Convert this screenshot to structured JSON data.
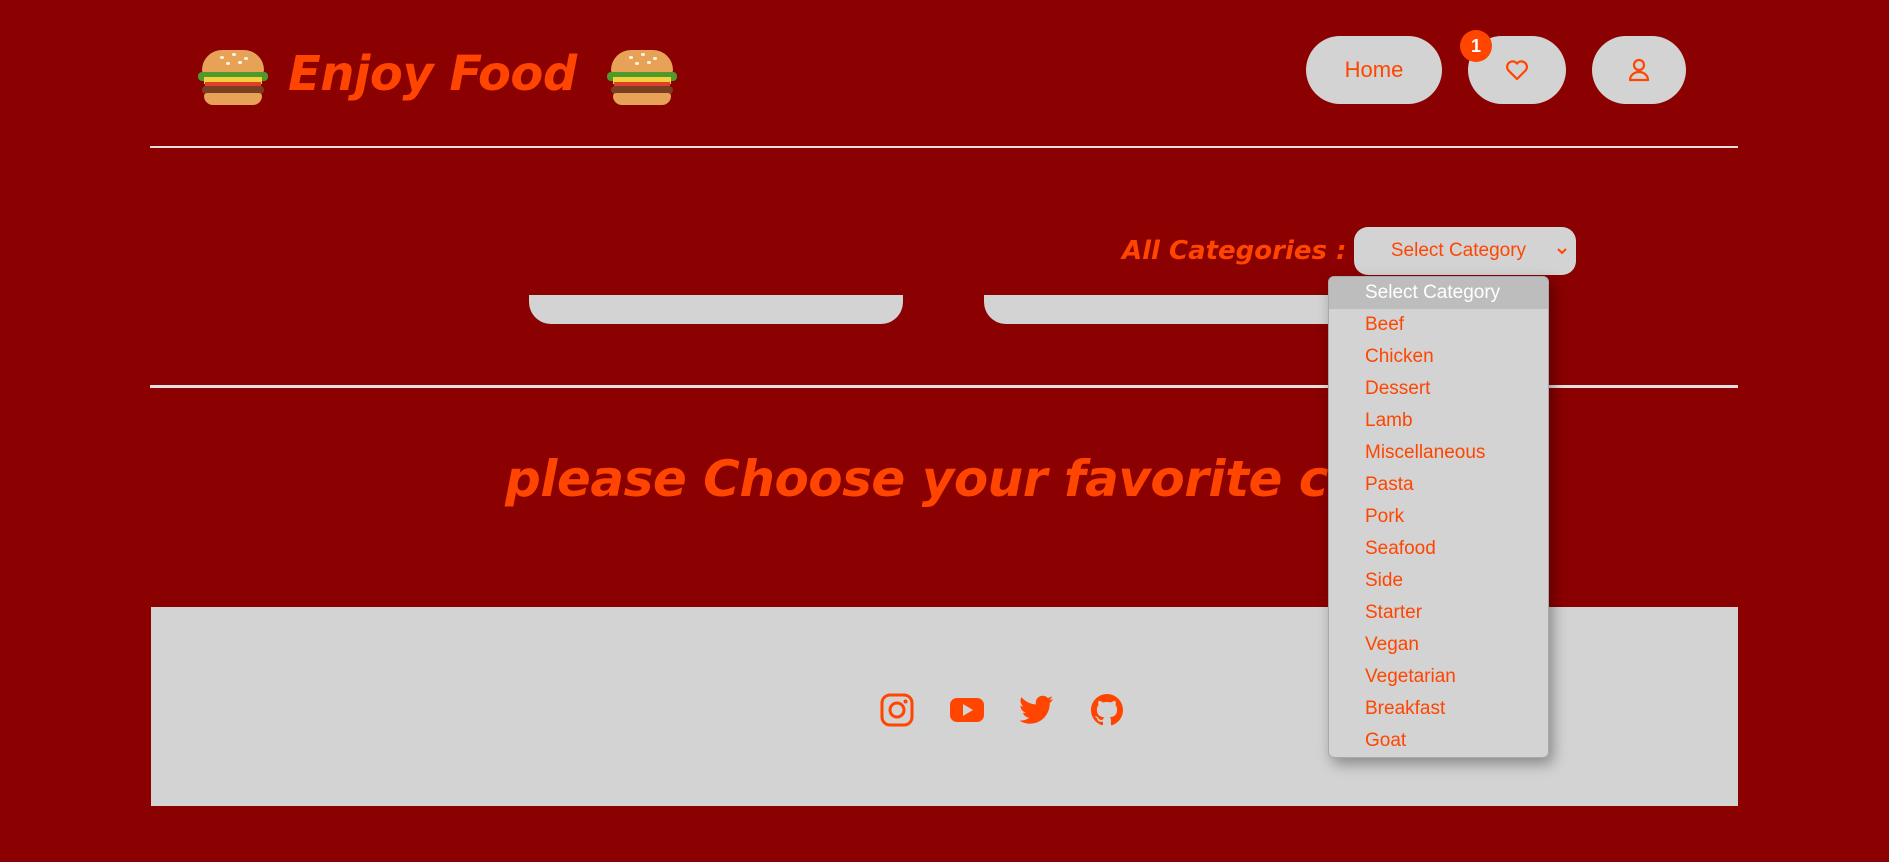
{
  "header": {
    "brand_title": "Enjoy Food",
    "nav": {
      "home_label": "Home",
      "favorites_count": "1",
      "favorites_icon": "heart-icon",
      "user_icon": "user-icon"
    }
  },
  "filter": {
    "label": "All Categories :",
    "selected": "Select Category",
    "options": [
      "Select Category",
      "Beef",
      "Chicken",
      "Dessert",
      "Lamb",
      "Miscellaneous",
      "Pasta",
      "Pork",
      "Seafood",
      "Side",
      "Starter",
      "Vegan",
      "Vegetarian",
      "Breakfast",
      "Goat"
    ]
  },
  "main": {
    "prompt": "please Choose your favorite category"
  },
  "footer": {
    "social": [
      "instagram-icon",
      "youtube-icon",
      "twitter-icon",
      "github-icon"
    ]
  },
  "colors": {
    "background": "#8b0000",
    "accent": "#ff4500",
    "surface": "#d3d3d3"
  }
}
